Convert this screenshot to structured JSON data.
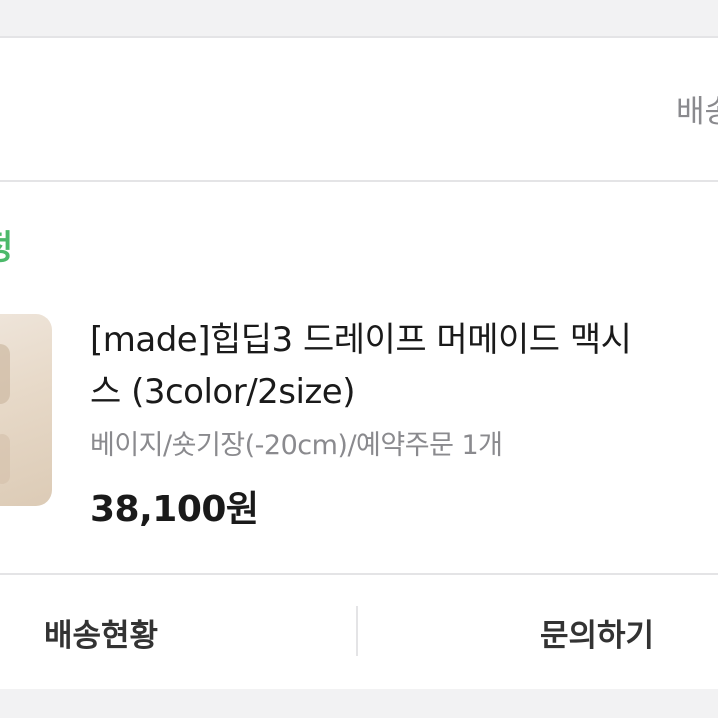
{
  "shipping": {
    "link_label": "배송"
  },
  "order": {
    "status_label": "정"
  },
  "product": {
    "name_line1": "[made]힙딥3 드레이프 머메이드 맥시",
    "name_line2": "스 (3color/2size)",
    "option": "베이지/숏기장(-20cm)/예약주문 1개",
    "price": "38,100원"
  },
  "actions": {
    "delivery_status_label": "배송현황",
    "inquiry_label": "문의하기"
  },
  "colors": {
    "status_green": "#4cb96a",
    "text_primary": "#1a1a1a",
    "text_secondary": "#8a8a8e",
    "divider": "#e4e4e6",
    "background_gray": "#f2f2f3"
  }
}
